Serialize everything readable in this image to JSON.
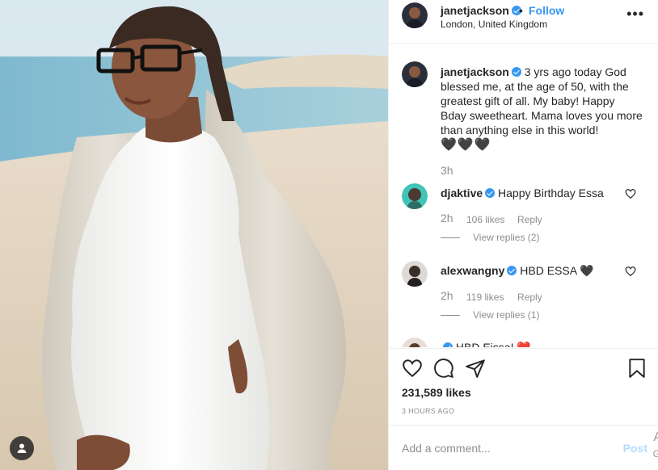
{
  "header": {
    "username": "janetjackson",
    "follow_label": "Follow",
    "dot": "•",
    "location": "London, United Kingdom",
    "more": "•••"
  },
  "caption": {
    "username": "janetjackson",
    "text": "3 yrs ago today God blessed me, at the age of 50, with the greatest gift of all. My baby! Happy Bday sweetheart. Mama loves you more than anything else in this world!",
    "hearts": "🖤🖤🖤",
    "time": "3h"
  },
  "comments": [
    {
      "username": "djaktive",
      "text": "Happy Birthday Essa",
      "time": "2h",
      "likes": "106 likes",
      "reply_label": "Reply",
      "view_replies": "View replies (2)"
    },
    {
      "username": "alexwangny",
      "text": "HBD ESSA 🖤",
      "time": "2h",
      "likes": "119 likes",
      "reply_label": "Reply",
      "view_replies": "View replies (1)"
    },
    {
      "username": "",
      "text": "HBD Eissa! ❤️"
    }
  ],
  "actions": {
    "likes_count": "231,589 likes",
    "time_ago": "3 HOURS AGO",
    "icons": [
      "heart-icon",
      "comment-icon",
      "share-icon",
      "bookmark-icon"
    ]
  },
  "add_comment": {
    "placeholder": "Add a comment...",
    "post_label": "Post",
    "edge_a": "A",
    "edge_g": "G"
  },
  "colors": {
    "accent": "#3897f0",
    "muted": "#8e8e8e",
    "text": "#262626",
    "post_disabled": "#b3dbff"
  }
}
